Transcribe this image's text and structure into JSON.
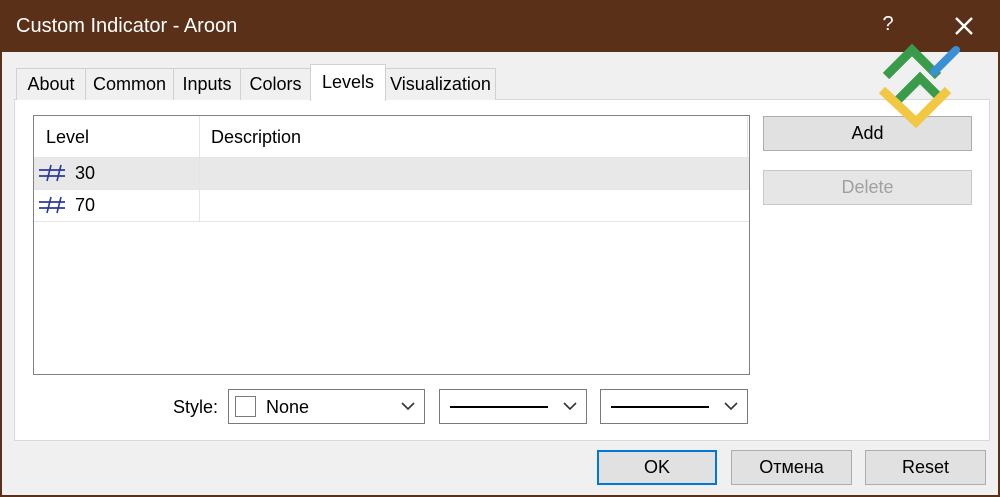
{
  "window": {
    "title": "Custom Indicator - Aroon",
    "help_label": "?",
    "close_icon": "close-icon"
  },
  "tabs": [
    {
      "label": "About",
      "active": false
    },
    {
      "label": "Common",
      "active": false
    },
    {
      "label": "Inputs",
      "active": false
    },
    {
      "label": "Colors",
      "active": false
    },
    {
      "label": "Levels",
      "active": true
    },
    {
      "label": "Visualization",
      "active": false
    }
  ],
  "levels": {
    "columns": {
      "level": "Level",
      "description": "Description"
    },
    "rows": [
      {
        "value": "30",
        "description": "",
        "selected": true
      },
      {
        "value": "70",
        "description": "",
        "selected": false
      }
    ]
  },
  "actions": {
    "add_label": "Add",
    "delete_label": "Delete"
  },
  "style": {
    "label": "Style:",
    "color_value": "None"
  },
  "footer": {
    "ok_label": "OK",
    "cancel_label": "Отмена",
    "reset_label": "Reset"
  },
  "colors": {
    "titlebar": "#5a3019",
    "accent": "#0078d7",
    "logo_green": "#3a9b4b",
    "logo_yellow": "#f2c744",
    "logo_blue": "#3b8fd6"
  }
}
